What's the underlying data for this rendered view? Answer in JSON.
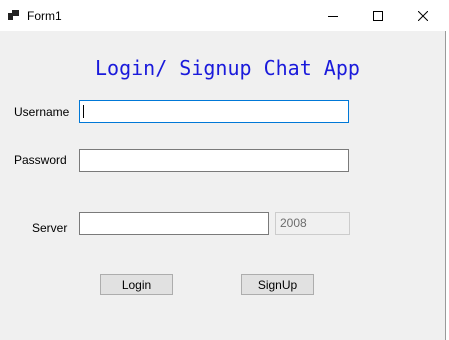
{
  "window": {
    "title": "Form1",
    "icons": {
      "app": "app-icon",
      "minimize": "minimize-icon",
      "maximize": "maximize-icon",
      "close": "close-icon"
    }
  },
  "form": {
    "heading": "Login/ Signup Chat App",
    "heading_color": "#1a1adb",
    "username": {
      "label": "Username",
      "value": ""
    },
    "password": {
      "label": "Password",
      "value": ""
    },
    "server": {
      "label": "Server",
      "value": "",
      "port": "2008"
    },
    "buttons": {
      "login": "Login",
      "signup": "SignUp"
    }
  }
}
